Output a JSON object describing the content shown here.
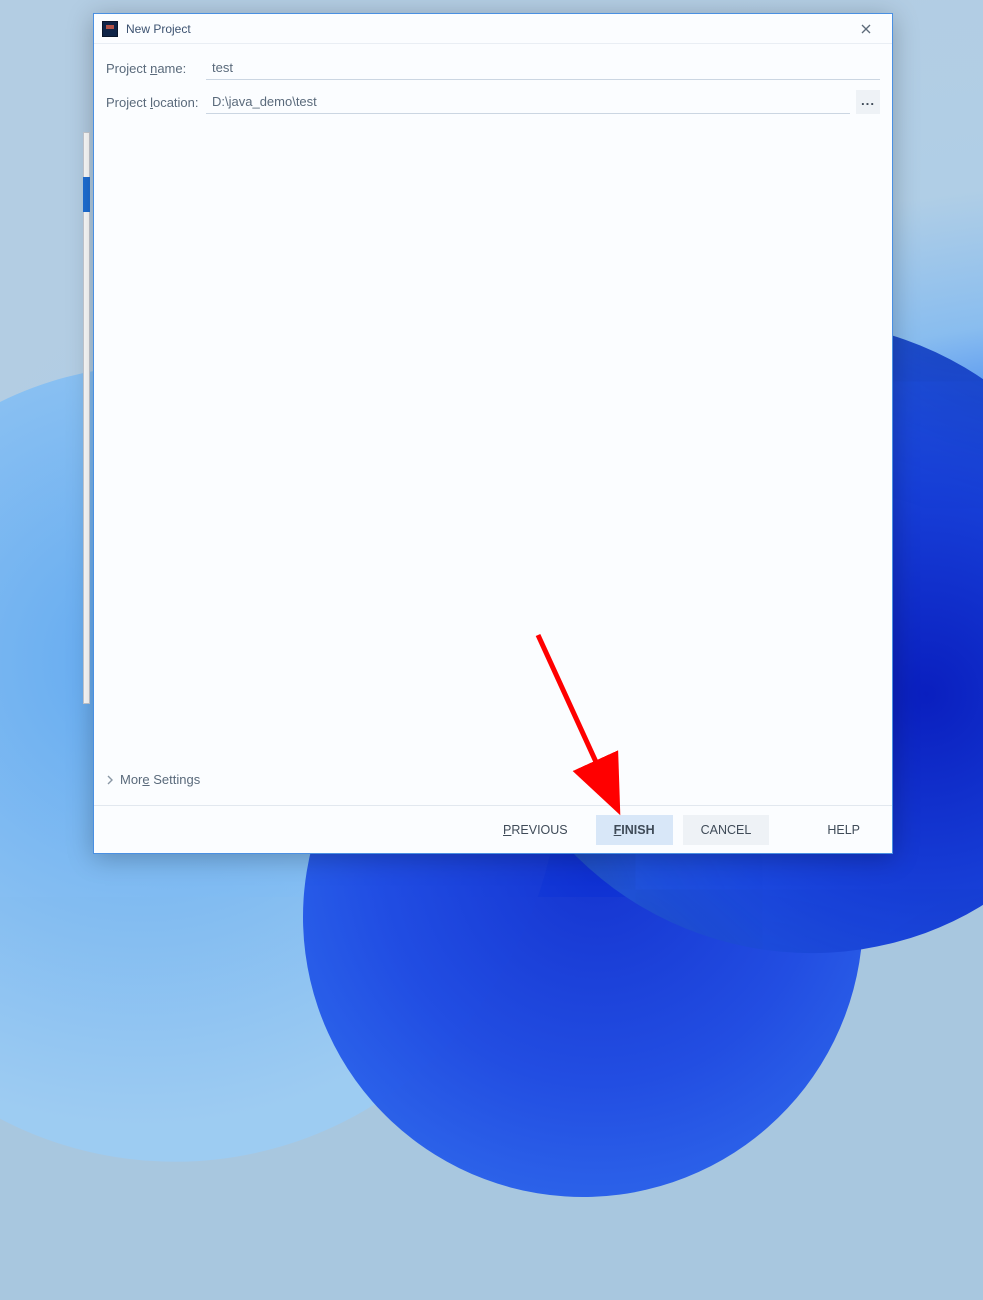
{
  "window": {
    "title": "New Project"
  },
  "form": {
    "name_label_pre": "Project ",
    "name_label_ul": "n",
    "name_label_post": "ame:",
    "name_value": "test",
    "location_label_pre": "Project ",
    "location_label_ul": "l",
    "location_label_post": "ocation:",
    "location_value": "D:\\java_demo\\test",
    "browse_label": "..."
  },
  "more": {
    "pre": "Mor",
    "ul": "e",
    "post": " Settings"
  },
  "buttons": {
    "previous_ul": "P",
    "previous_rest": "REVIOUS",
    "finish_ul": "F",
    "finish_rest": "INISH",
    "cancel": "CANCEL",
    "help": "HELP"
  },
  "annotation": {
    "arrow_color": "#ff0000"
  }
}
